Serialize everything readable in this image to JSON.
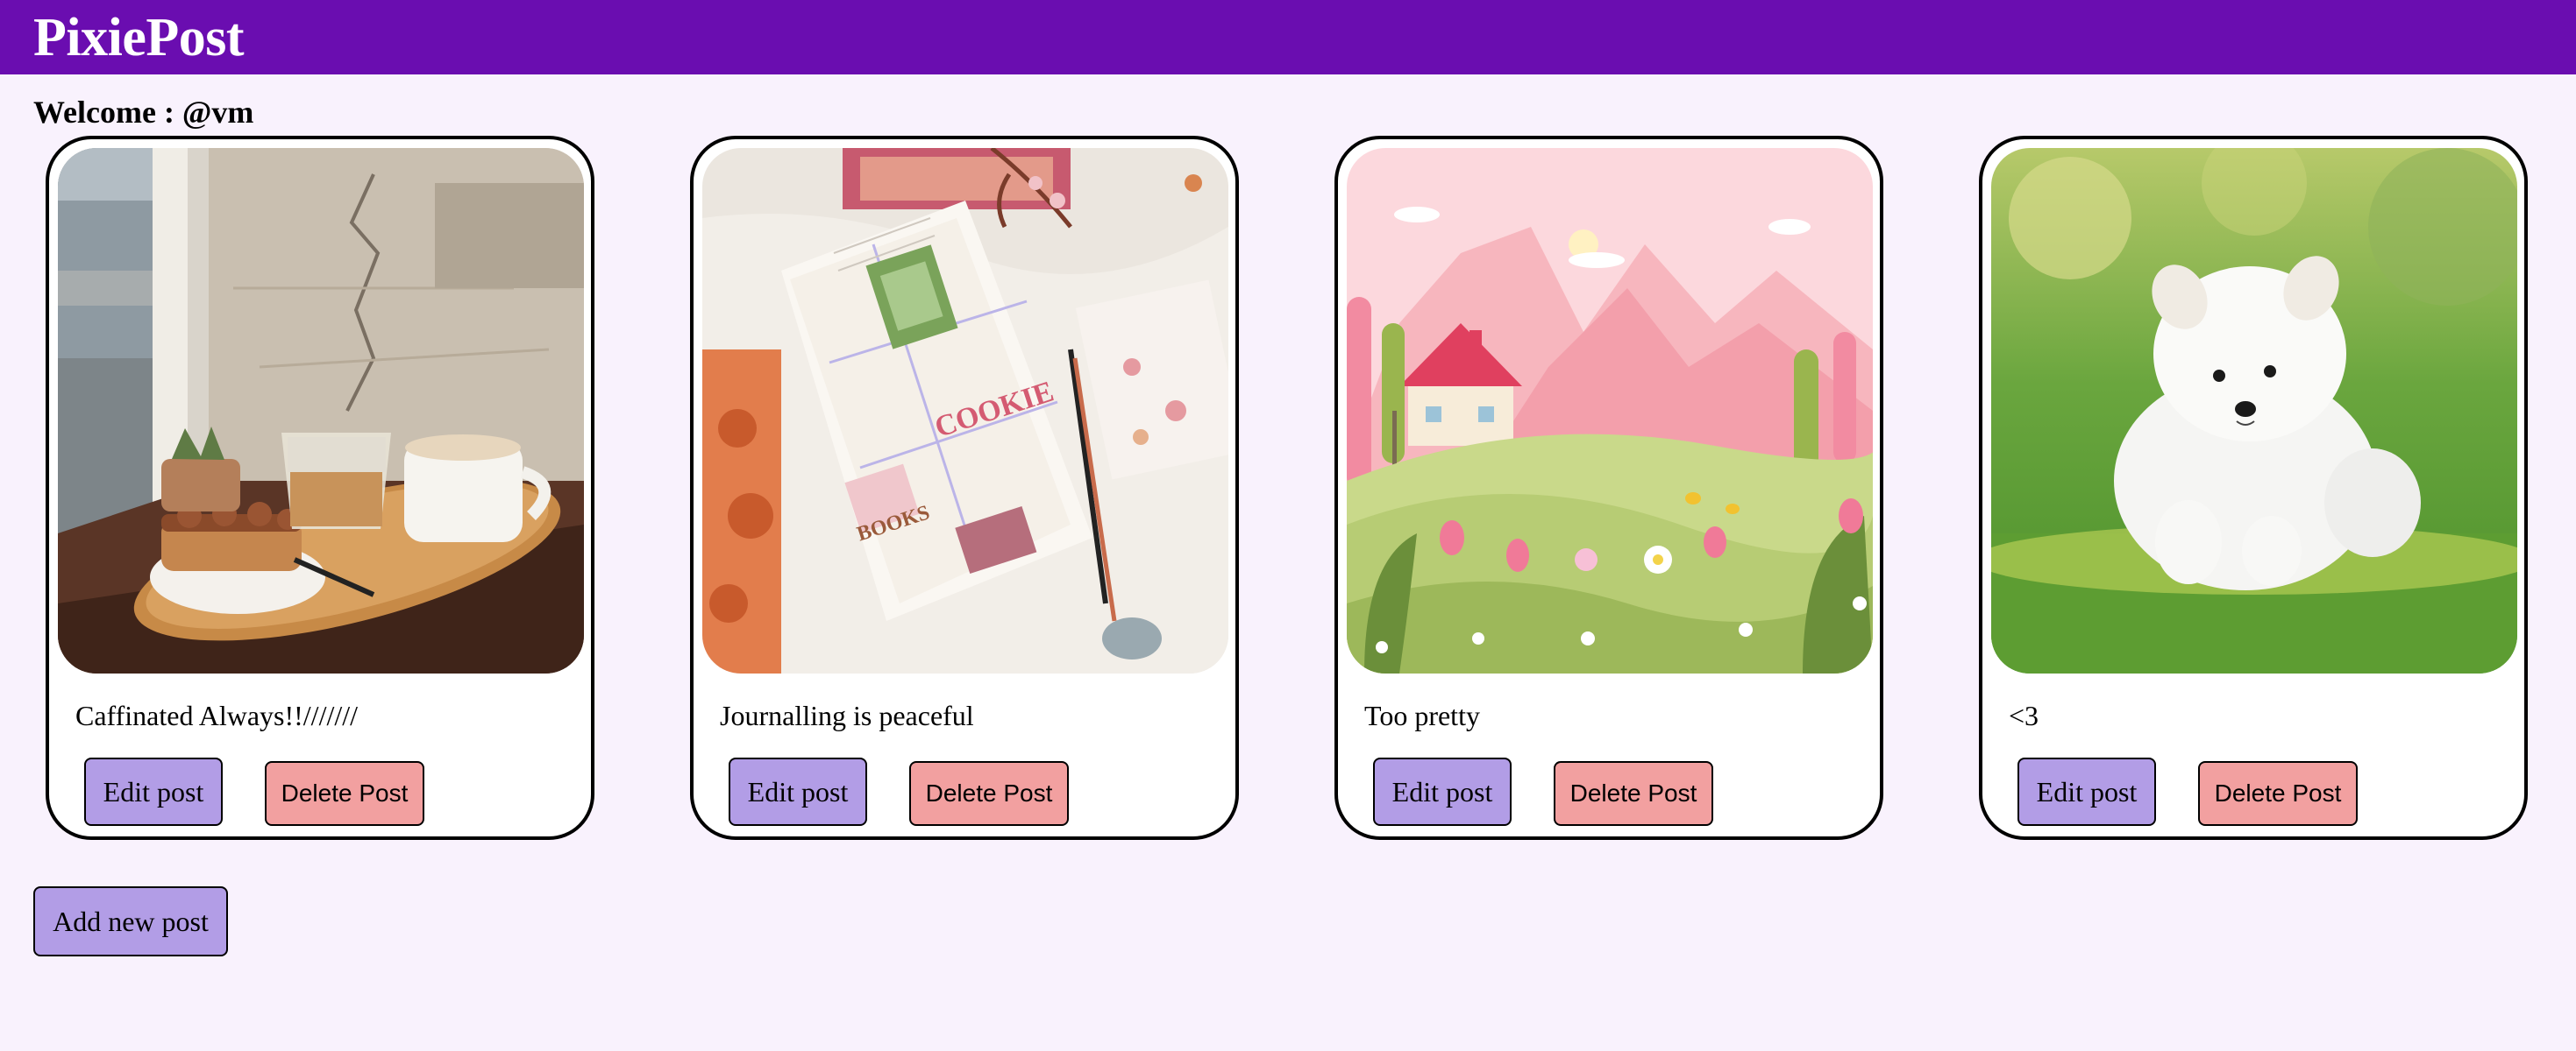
{
  "app": {
    "title": "PixiePost"
  },
  "welcome": "Welcome : @vm",
  "posts": [
    {
      "caption": "Caffinated Always!!///////",
      "image": "coffee-and-cake-on-windowsill",
      "edit_label": "Edit post",
      "delete_label": "Delete Post"
    },
    {
      "caption": "Journalling is peaceful",
      "image": "open-journal-with-stickers",
      "edit_label": "Edit post",
      "delete_label": "Delete Post"
    },
    {
      "caption": "Too pretty",
      "image": "pink-cartoon-landscape-with-house",
      "edit_label": "Edit post",
      "delete_label": "Delete Post"
    },
    {
      "caption": "<3",
      "image": "white-fluffy-puppy-on-grass",
      "edit_label": "Edit post",
      "delete_label": "Delete Post"
    }
  ],
  "add_post_label": "Add new post",
  "colors": {
    "header": "#6a0db0",
    "background": "#f9f2fd",
    "edit_button": "#b29de6",
    "delete_button": "#f2a0a0"
  }
}
